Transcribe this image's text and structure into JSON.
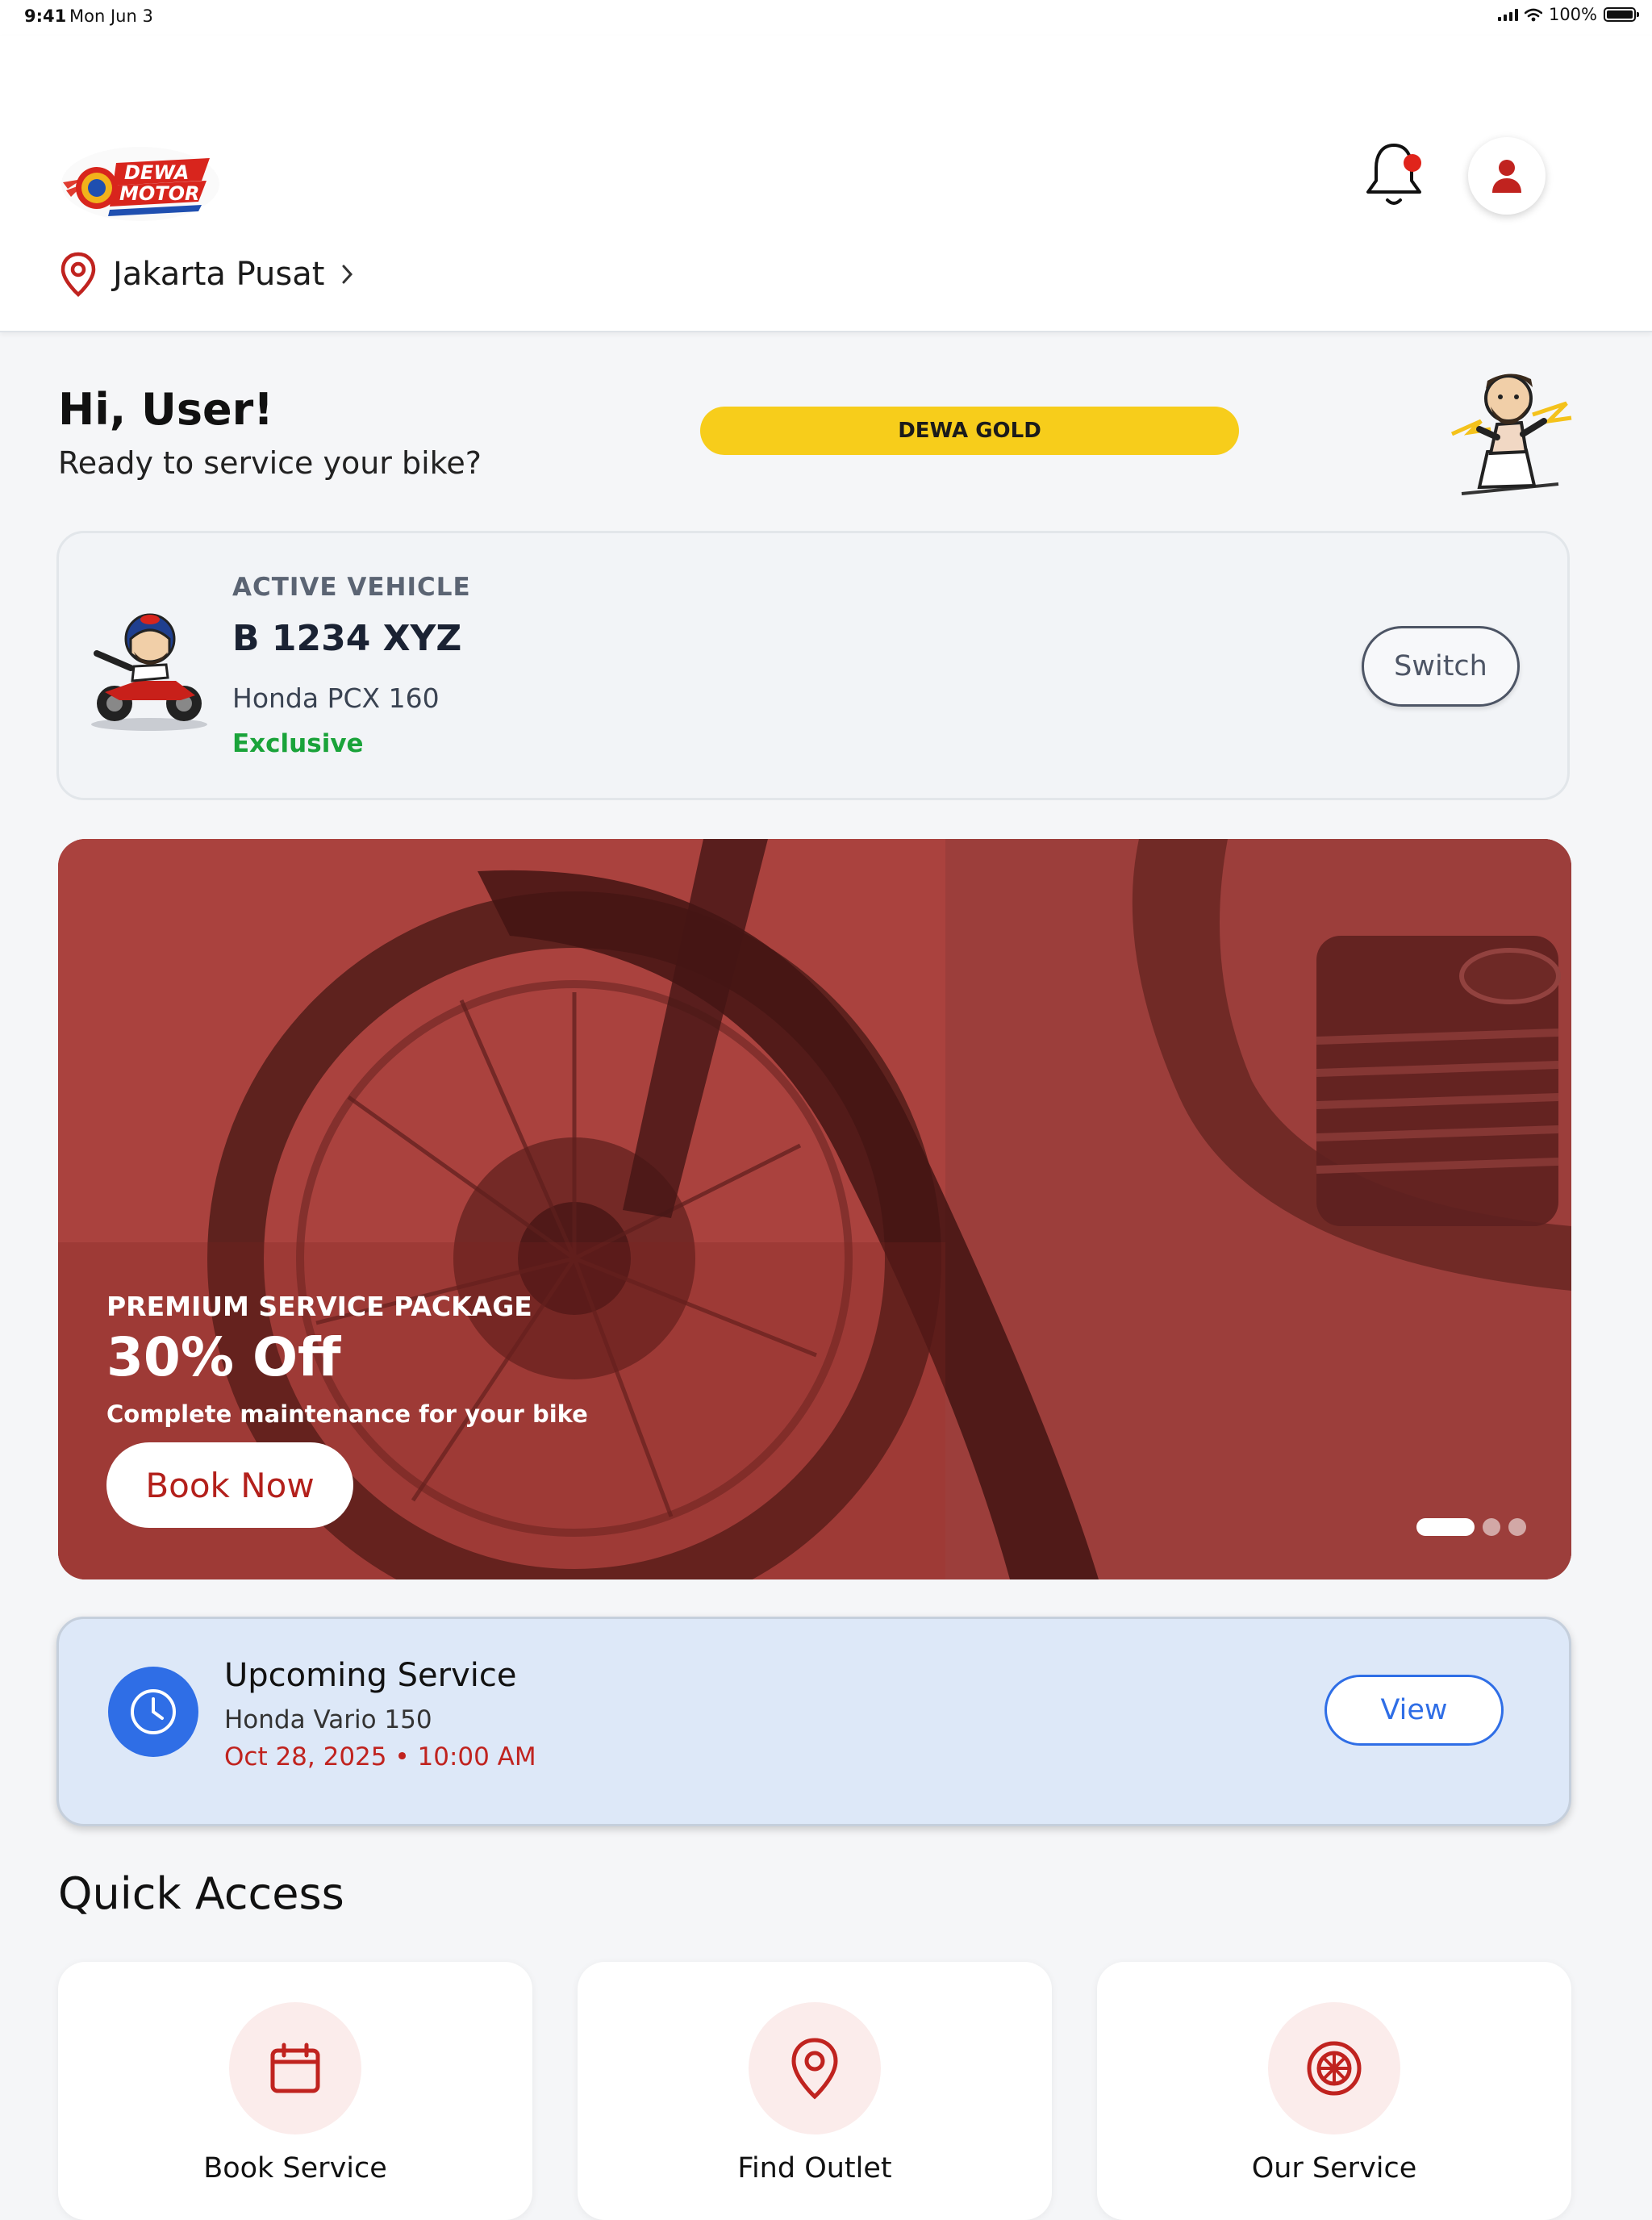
{
  "status_bar": {
    "time": "9:41",
    "date": "Mon Jun 3",
    "battery": "100%"
  },
  "header": {
    "logo_text": "DEWA MOTOR",
    "location": "Jakarta Pusat",
    "has_unread_notifications": true,
    "icons": [
      "location-pin-icon",
      "chevron-right-icon",
      "bell-icon",
      "user-icon"
    ]
  },
  "greeting": {
    "title": "Hi, User!",
    "subtitle": "Ready to service your bike?",
    "tier": "DEWA GOLD"
  },
  "vehicle": {
    "kicker": "ACTIVE VEHICLE",
    "plate": "B 1234 XYZ",
    "model": "Honda PCX 160",
    "tier": "Exclusive",
    "switch_label": "Switch"
  },
  "promo": {
    "kicker": "PREMIUM SERVICE PACKAGE",
    "title": "30% Off",
    "description": "Complete maintenance for your bike",
    "button": "Book Now",
    "slides": 3,
    "active_slide": 1
  },
  "upcoming": {
    "title": "Upcoming Service",
    "vehicle": "Honda Vario 150",
    "datetime": "Oct 28, 2025 • 10:00 AM",
    "button": "View"
  },
  "quick_access": {
    "title": "Quick Access",
    "items": [
      {
        "label": "Book Service",
        "icon": "calendar-icon"
      },
      {
        "label": "Find Outlet",
        "icon": "location-pin-icon"
      },
      {
        "label": "Our Service",
        "icon": "wheel-icon"
      }
    ]
  },
  "colors": {
    "brand_red": "#c0231f",
    "gold": "#f7cd1b",
    "blue": "#2f6ee6",
    "success_green": "#1aa33a"
  }
}
